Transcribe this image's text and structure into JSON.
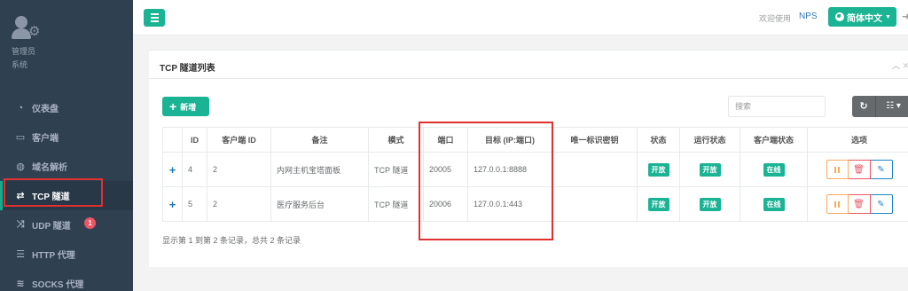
{
  "sidebar": {
    "user_name": "管理员",
    "user_role": "系统",
    "items": [
      {
        "label": "仪表盘",
        "icon": "dashboard-icon"
      },
      {
        "label": "客户端",
        "icon": "desktop-icon"
      },
      {
        "label": "域名解析",
        "icon": "globe-icon"
      },
      {
        "label": "TCP 隧道",
        "icon": "retweet-icon",
        "active": true
      },
      {
        "label": "UDP 隧道",
        "icon": "random-icon",
        "badge": "1"
      },
      {
        "label": "HTTP 代理",
        "icon": "server-icon"
      },
      {
        "label": "SOCKS 代理",
        "icon": "database-icon"
      }
    ]
  },
  "topbar": {
    "welcome": "欢迎使用",
    "brand": "NPS",
    "language": "简体中文"
  },
  "panel": {
    "title": "TCP 隧道列表",
    "add_label": "新增",
    "search_placeholder": "搜索",
    "columns": [
      "",
      "ID",
      "客户端 ID",
      "备注",
      "模式",
      "端口",
      "目标 (IP:端口)",
      "唯一标识密钥",
      "状态",
      "运行状态",
      "客户端状态",
      "选项"
    ],
    "rows": [
      {
        "id": "4",
        "client_id": "2",
        "remark": "内网主机宝塔面板",
        "mode": "TCP 隧道",
        "port": "20005",
        "target": "127.0.0.1:8888",
        "key": "",
        "status": "开放",
        "run_status": "开放",
        "client_status": "在线"
      },
      {
        "id": "5",
        "client_id": "2",
        "remark": "医疗服务后台",
        "mode": "TCP 隧道",
        "port": "20006",
        "target": "127.0.0.1:443",
        "key": "",
        "status": "开放",
        "run_status": "开放",
        "client_status": "在线"
      }
    ],
    "summary": "显示第 1 到第 2 条记录，总共 2 条记录"
  },
  "colors": {
    "sidebar_bg": "#2f4050",
    "accent": "#1ab394",
    "highlight_box": "#e03030"
  }
}
